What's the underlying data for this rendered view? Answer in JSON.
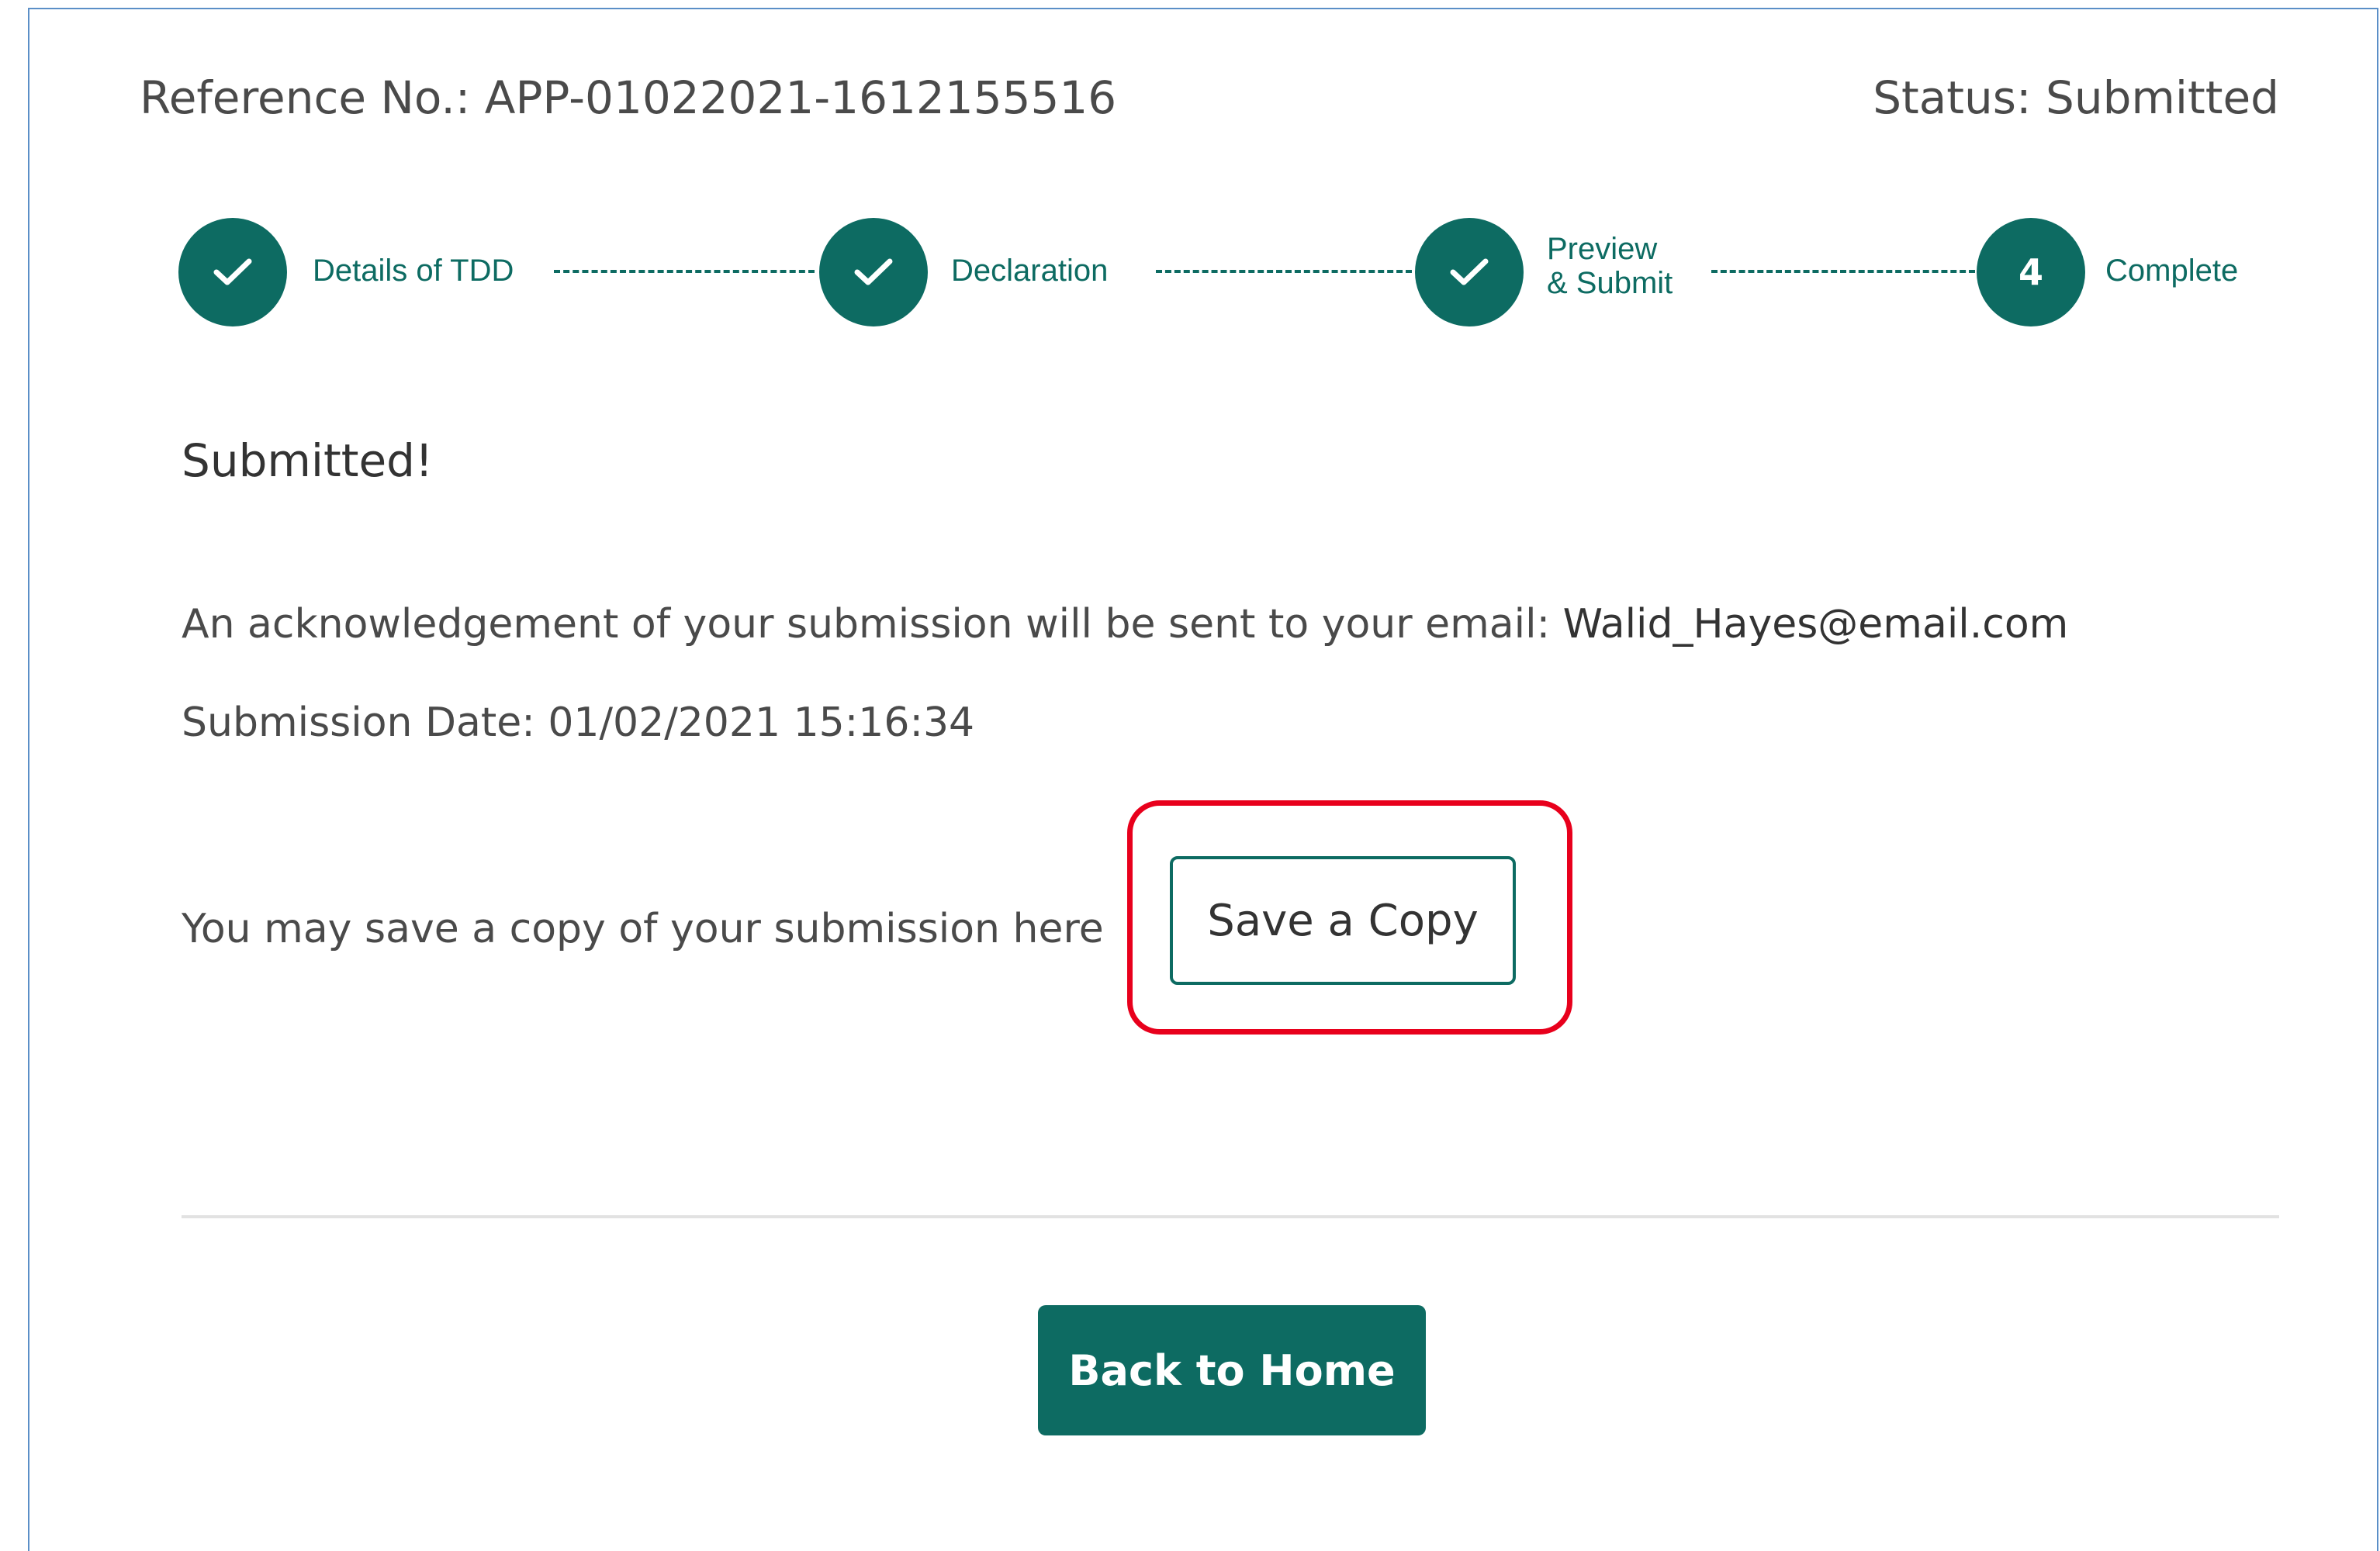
{
  "header": {
    "reference": "Reference No.: APP-01022021-1612155516",
    "status": "Status: Submitted"
  },
  "stepper": {
    "steps": [
      {
        "label": "Details of TDD",
        "state": "done",
        "icon": "check-icon"
      },
      {
        "label": "Declaration",
        "state": "done",
        "icon": "check-icon"
      },
      {
        "label_line1": "Preview",
        "label_line2": "& Submit",
        "state": "done",
        "icon": "check-icon"
      },
      {
        "label": "Complete",
        "state": "current",
        "number": "4"
      }
    ]
  },
  "content": {
    "heading": "Submitted!",
    "ack_text": "An acknowledgement of your submission will be sent to your email: ",
    "email": "Walid_Hayes@email.com",
    "submission_date": "Submission Date: 01/02/2021 15:16:34",
    "save_prompt": "You may save a copy of your submission here",
    "save_button": "Save a Copy",
    "home_button": "Back to Home"
  },
  "colors": {
    "accent": "#0d6b62",
    "highlight": "#e8001c",
    "frame_border": "#5b8fc7"
  }
}
